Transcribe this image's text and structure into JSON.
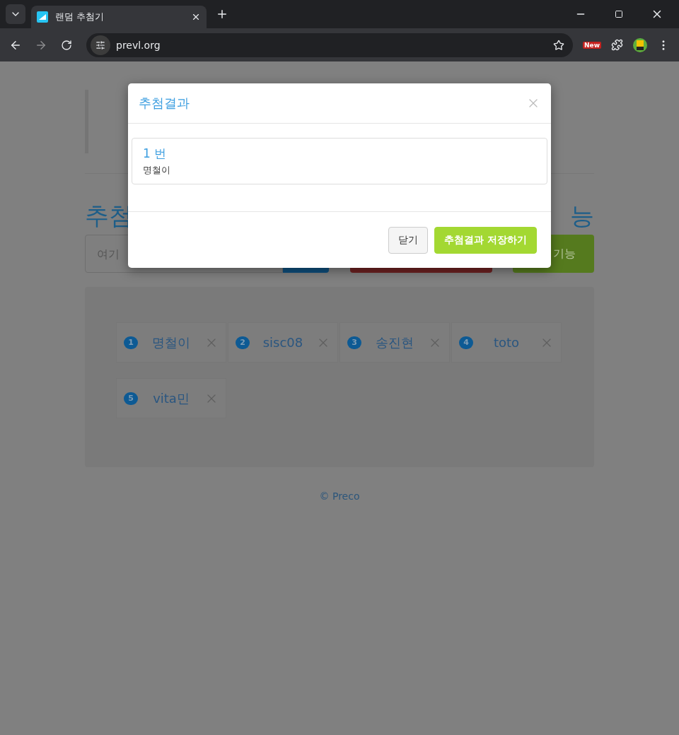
{
  "browser": {
    "tab_title": "랜덤 추첨기",
    "url": "prevl.org",
    "badge": "New"
  },
  "page": {
    "heading_left": "추첨",
    "heading_right": "능",
    "input_placeholder": "여기",
    "action_button": "기능",
    "entries": [
      {
        "number": "1",
        "name": "명철이"
      },
      {
        "number": "2",
        "name": "sisc08"
      },
      {
        "number": "3",
        "name": "송진현"
      },
      {
        "number": "4",
        "name": "toto"
      },
      {
        "number": "5",
        "name": "vita민"
      }
    ],
    "footer": "© Preco"
  },
  "modal": {
    "title": "추첨결과",
    "results": [
      {
        "rank": "1 번",
        "name": "명철이"
      }
    ],
    "buttons": [
      {
        "label": "닫기",
        "kind": "default"
      },
      {
        "label": "추첨결과 저장하기",
        "kind": "primary"
      }
    ]
  }
}
